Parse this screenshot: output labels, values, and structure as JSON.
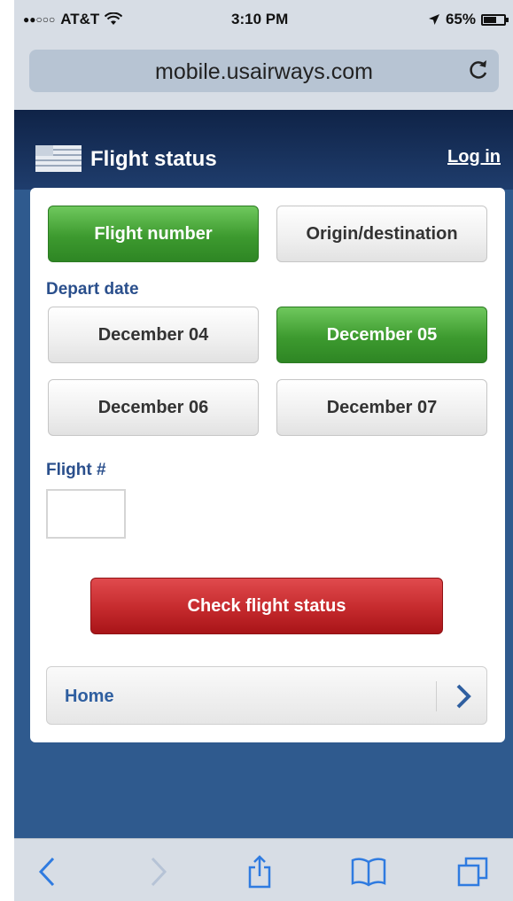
{
  "status_bar": {
    "carrier": "AT&T",
    "time": "3:10 PM",
    "battery_percent": "65%",
    "battery_level": 0.65
  },
  "browser": {
    "url": "mobile.usairways.com"
  },
  "header": {
    "title": "Flight status",
    "login": "Log in"
  },
  "search_mode": {
    "options": [
      "Flight number",
      "Origin/destination"
    ],
    "selected": "Flight number"
  },
  "depart_date": {
    "label": "Depart date",
    "options": [
      "December 04",
      "December 05",
      "December 06",
      "December 07"
    ],
    "selected": "December 05"
  },
  "flight_number": {
    "label": "Flight #",
    "value": ""
  },
  "actions": {
    "check_label": "Check flight status"
  },
  "nav": {
    "home": "Home"
  },
  "colors": {
    "accent_green": "#3d9a2f",
    "action_red": "#c52a2d",
    "page_blue": "#2f5a8e",
    "header_navy": "#0f2347"
  },
  "toolbar": {
    "icons": [
      "back-icon",
      "forward-icon",
      "share-icon",
      "bookmarks-icon",
      "tabs-icon"
    ]
  }
}
